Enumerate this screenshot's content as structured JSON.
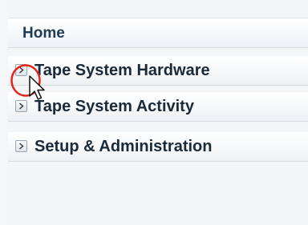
{
  "nav": {
    "header": "Home",
    "items": [
      {
        "label": "Tape System Hardware",
        "expanded": false
      },
      {
        "label": "Tape System Activity",
        "expanded": false
      },
      {
        "label": "Setup & Administration",
        "expanded": false
      }
    ]
  },
  "icons": {
    "disclosure": "chevron-right-icon",
    "cursor": "mouse-pointer-icon",
    "annotation": "red-circle-highlight"
  },
  "colors": {
    "header_text": "#1f3b56",
    "item_text": "#1b2a38",
    "highlight": "#e0261f"
  }
}
